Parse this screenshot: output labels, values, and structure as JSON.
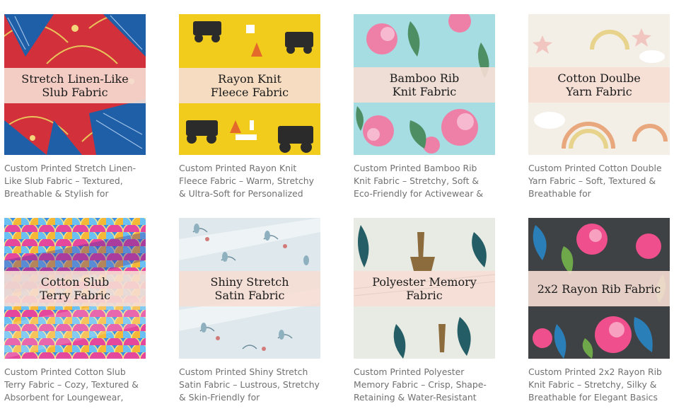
{
  "products": [
    {
      "title": "Stretch Linen-Like\nSlub Fabric",
      "description": "Custom Printed Stretch Linen-Like Slub Fabric – Textured, Breathable & Stylish for",
      "pattern": "red-blue-fan-floral",
      "colors": [
        "#d2303b",
        "#1f5fa8",
        "#e8c45a"
      ]
    },
    {
      "title": "Rayon Knit\nFleece Fabric",
      "description": "Custom Printed Rayon Knit Fleece Fabric – Warm, Stretchy & Ultra-Soft for Personalized",
      "pattern": "yellow-construction-trucks",
      "colors": [
        "#f2cc1c",
        "#2b2b2b",
        "#ffffff"
      ]
    },
    {
      "title": "Bamboo Rib\nKnit Fabric",
      "description": "Custom Printed Bamboo Rib Knit Fabric – Stretchy, Soft & Eco-Friendly for Activewear &",
      "pattern": "aqua-pink-hibiscus",
      "colors": [
        "#a6dde3",
        "#ee7fa7",
        "#4e8e63"
      ]
    },
    {
      "title": "Cotton Doulbe\nYarn Fabric",
      "description": "Custom Printed Cotton Double Yarn Fabric – Soft, Textured & Breathable for",
      "pattern": "cream-rainbows-stars",
      "colors": [
        "#f3eee6",
        "#e8a77d",
        "#e7d38b"
      ]
    },
    {
      "title": "Cotton Slub\nTerry Fabric",
      "description": "Custom Printed Cotton Slub Terry Fabric – Cozy, Textured & Absorbent for Loungewear,",
      "pattern": "rainbow-mermaid-scales",
      "colors": [
        "#3a8de0",
        "#e5479c",
        "#f5b736"
      ]
    },
    {
      "title": "Shiny Stretch\nSatin Fabric",
      "description": "Custom Printed Shiny Stretch Satin Fabric – Lustrous, Stretchy & Skin-Friendly for",
      "pattern": "pale-blue-sprigs",
      "colors": [
        "#dfe8ed",
        "#6d8d9c",
        "#d27a78"
      ]
    },
    {
      "title": "Polyester Memory\nFabric",
      "description": "Custom Printed Polyester Memory Fabric – Crisp, Shape-Retaining & Water-Resistant",
      "pattern": "toile-jungle",
      "colors": [
        "#e8ebe3",
        "#245d65",
        "#8c6b3c"
      ]
    },
    {
      "title": "2x2 Rayon Rib Fabric",
      "description": "Custom Printed 2x2 Rayon Rib Knit Fabric – Stretchy, Silky & Breathable for Elegant Basics",
      "pattern": "dark-tropical-floral",
      "colors": [
        "#3e4244",
        "#ef4f8c",
        "#2a7fb8"
      ]
    }
  ]
}
